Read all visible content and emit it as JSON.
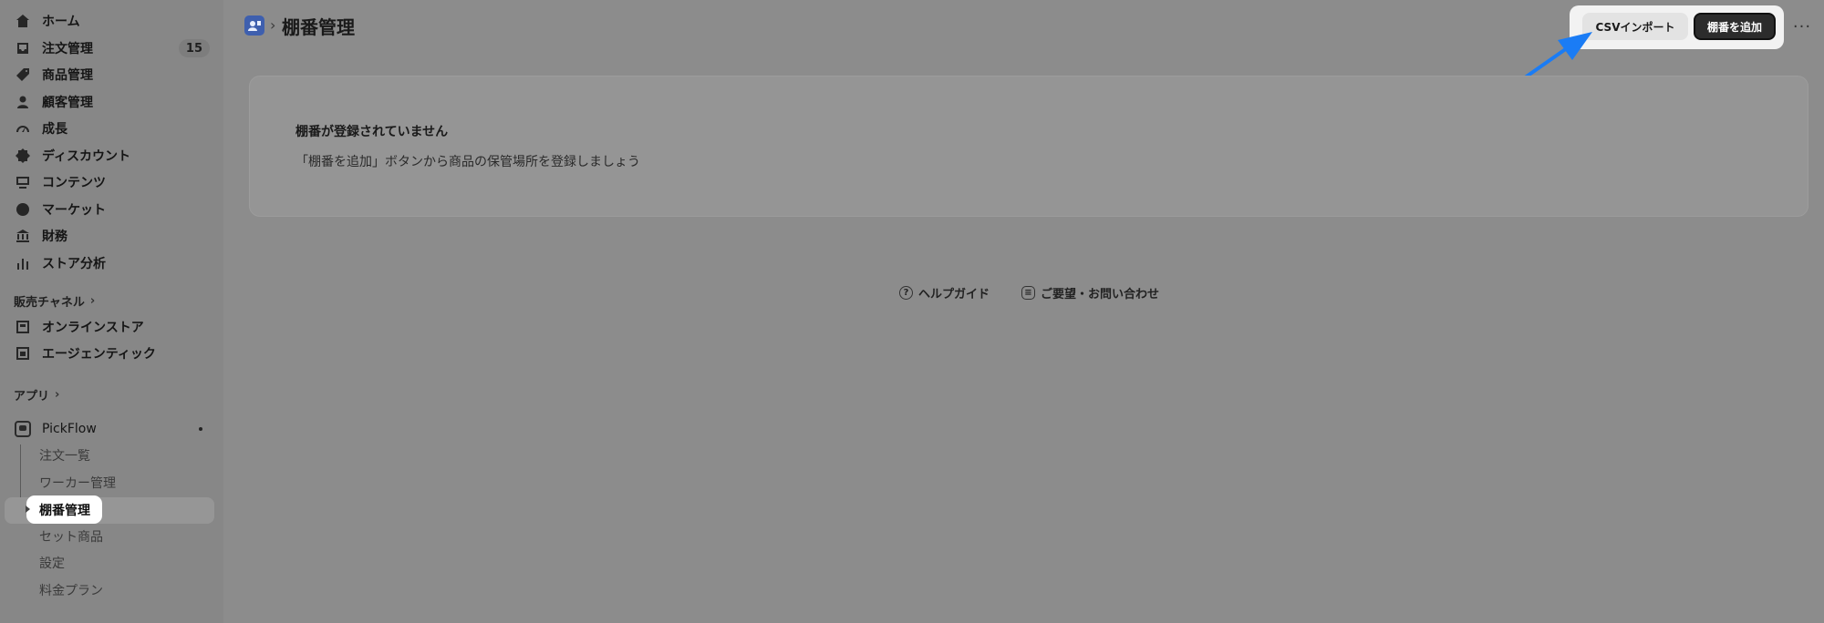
{
  "sidebar": {
    "nav": [
      {
        "label": "ホーム",
        "icon": "home-icon"
      },
      {
        "label": "注文管理",
        "icon": "inbox-icon",
        "badge": "15"
      },
      {
        "label": "商品管理",
        "icon": "tag-icon"
      },
      {
        "label": "顧客管理",
        "icon": "person-icon"
      },
      {
        "label": "成長",
        "icon": "gauge-icon"
      },
      {
        "label": "ディスカウント",
        "icon": "discount-icon"
      },
      {
        "label": "コンテンツ",
        "icon": "content-icon"
      },
      {
        "label": "マーケット",
        "icon": "globe-icon"
      },
      {
        "label": "財務",
        "icon": "bank-icon"
      },
      {
        "label": "ストア分析",
        "icon": "bar-chart-icon"
      }
    ],
    "sales_channels_label": "販売チャネル",
    "channels": [
      {
        "label": "オンラインストア",
        "icon": "store-icon"
      },
      {
        "label": "エージェンティック",
        "icon": "agent-icon"
      }
    ],
    "apps_label": "アプリ",
    "app": {
      "name": "PickFlow",
      "sub_items": [
        "注文一覧",
        "ワーカー管理",
        "棚番管理",
        "セット商品",
        "設定",
        "料金プラン"
      ],
      "selected": "棚番管理"
    }
  },
  "header": {
    "title": "棚番管理",
    "csv_button": "CSVインポート",
    "add_button": "棚番を追加",
    "more": "···"
  },
  "empty_state": {
    "title": "棚番が登録されていません",
    "description": "「棚番を追加」ボタンから商品の保管場所を登録しましょう"
  },
  "footer": {
    "help": "ヘルプガイド",
    "contact": "ご要望・お問い合わせ"
  },
  "colors": {
    "annotation_arrow": "#1a7cf5",
    "primary_button": "#2c2c2c"
  }
}
